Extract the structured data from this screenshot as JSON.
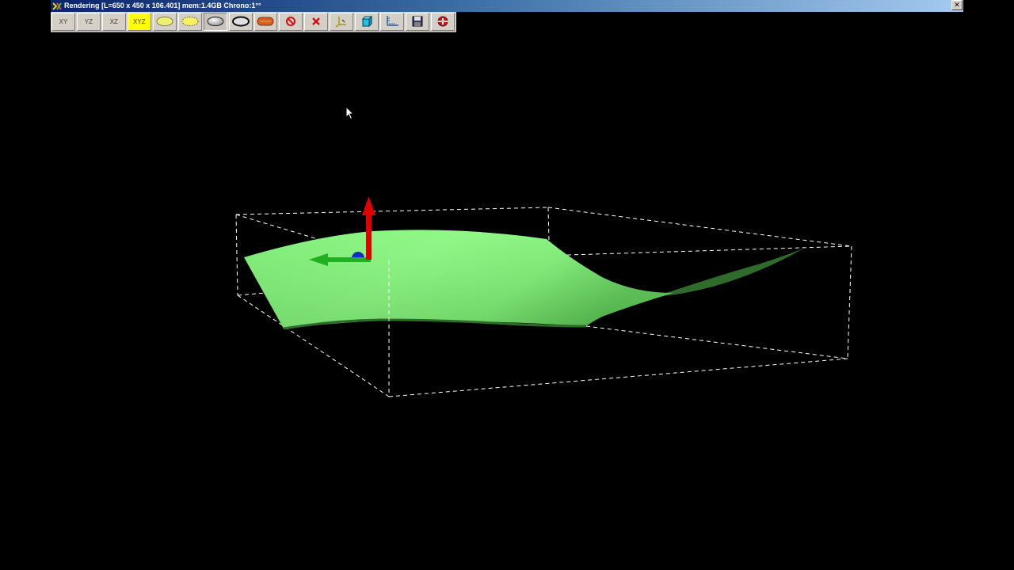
{
  "window": {
    "title": "Rendering [L=650 x 450 x 106.401] mem:1.4GB Chrono:1°°",
    "close_glyph": "✕"
  },
  "toolbar": {
    "view_xy": "XY",
    "view_yz": "YZ",
    "view_xz": "XZ",
    "view_xyz": "XYZ",
    "icons": [
      "wireframe-ellipse-icon",
      "dotted-ellipse-icon",
      "shaded-ellipse-icon",
      "outline-ellipse-icon",
      "textured-shape-icon",
      "stop-icon",
      "delete-icon",
      "axes-icon",
      "cube-icon",
      "measure-icon",
      "save-icon",
      "add-remove-icon"
    ]
  },
  "colors": {
    "background": "#000000",
    "surface": "#7CF074",
    "surface_dark": "#3A7A35",
    "axis_z": "#E00000",
    "axis_y": "#20B020",
    "axis_x": "#1030C0",
    "bounding_box": "#FFFFFF",
    "title_bar_start": "#0A246A",
    "toolbar_highlight": "#FFFF00"
  }
}
